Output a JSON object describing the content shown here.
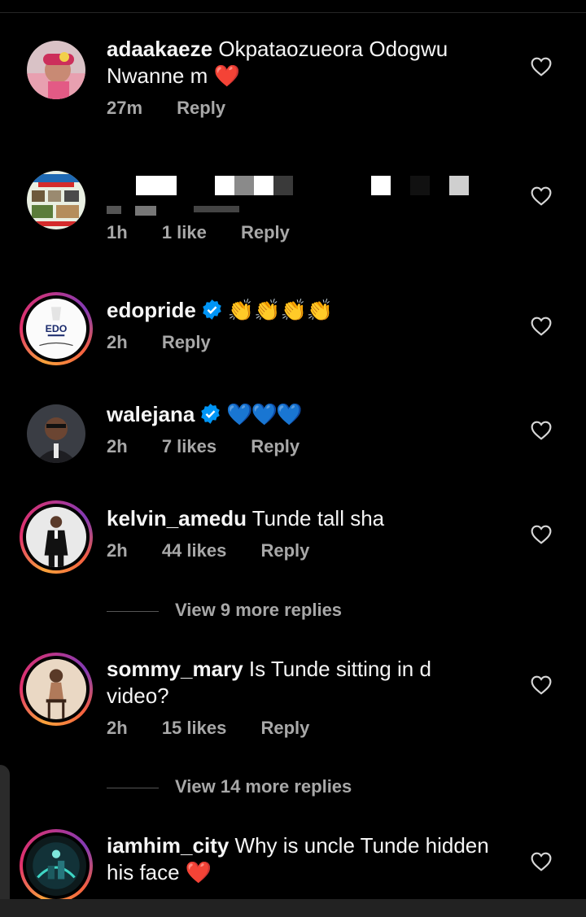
{
  "comments": [
    {
      "username": "adaakaeze",
      "text": "Okpataozueora Odogwu",
      "text2": "Nwanne m ❤️",
      "time": "27m",
      "likes": "",
      "reply": "Reply",
      "avatar": "girl-photo-icon"
    },
    {
      "username": "",
      "text": "",
      "time": "1h",
      "likes": "1 like",
      "reply": "Reply",
      "avatar": "pet-logistics-poster-icon"
    },
    {
      "username": "edopride",
      "text": "👏👏👏👏",
      "time": "2h",
      "likes": "",
      "reply": "Reply",
      "avatar": "edo-logo-icon",
      "avatar_text": "EDO",
      "verified": true
    },
    {
      "username": "walejana",
      "text": "💙💙💙",
      "time": "2h",
      "likes": "7 likes",
      "reply": "Reply",
      "avatar": "man-photo-icon",
      "verified": true
    },
    {
      "username": "kelvin_amedu",
      "text": "Tunde tall sha",
      "time": "2h",
      "likes": "44 likes",
      "reply": "Reply",
      "avatar": "man-in-suit-photo-icon",
      "view_more": "View 9 more replies"
    },
    {
      "username": "sommy_mary",
      "text": "Is Tunde sitting in d",
      "text2": "video?",
      "time": "2h",
      "likes": "15 likes",
      "reply": "Reply",
      "avatar": "woman-photo-icon",
      "view_more": "View 14 more replies"
    },
    {
      "username": "iamhim_city",
      "text": "Why is uncle Tunde hidden",
      "text2": "his face ❤️",
      "avatar": "city-art-icon"
    }
  ],
  "colors": {
    "background": "#000000",
    "text": "#f5f5f5",
    "muted": "#a8a8a8",
    "verified": "#0095f6",
    "heart_emoji": "#e0242b"
  }
}
